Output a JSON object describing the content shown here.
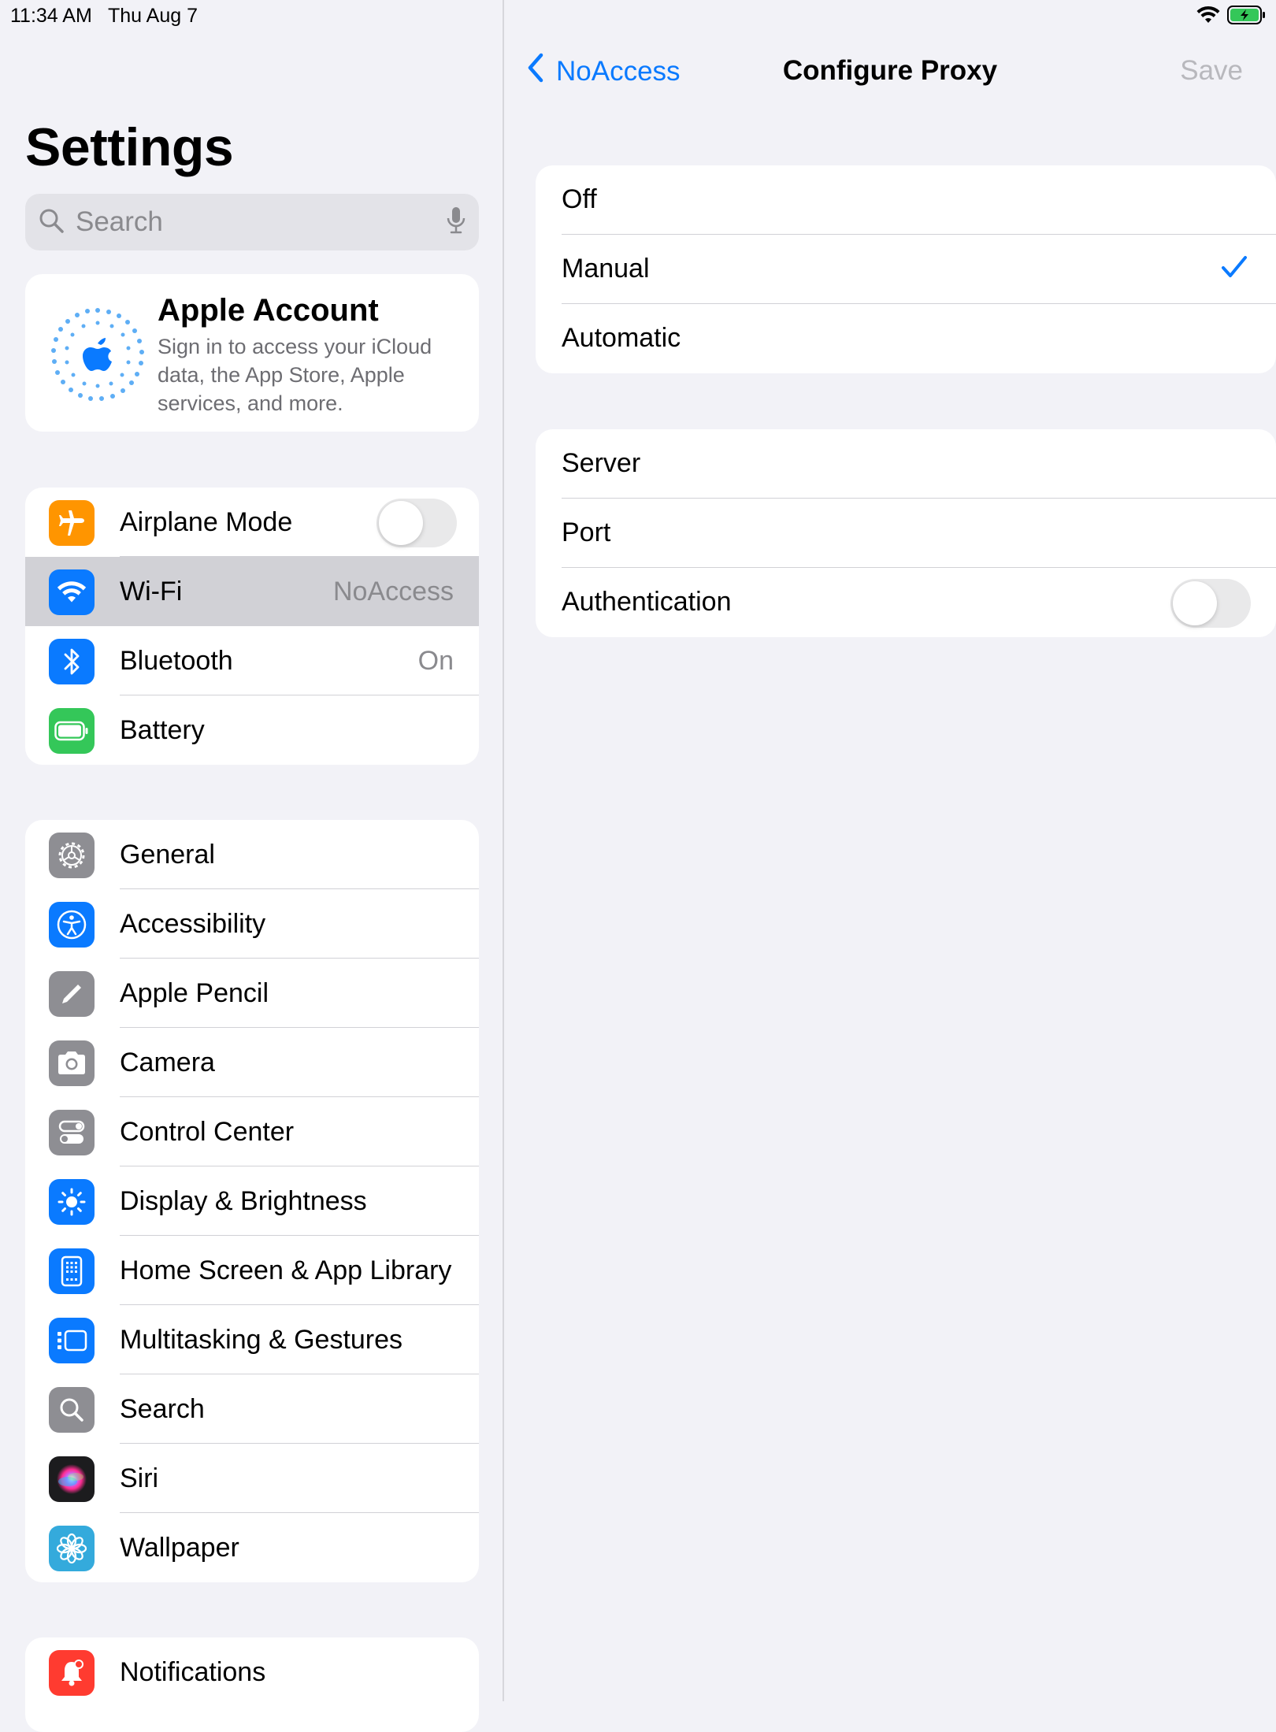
{
  "status_bar": {
    "time": "11:34 AM",
    "date": "Thu Aug 7"
  },
  "sidebar": {
    "title": "Settings",
    "search": {
      "placeholder": "Search"
    },
    "account": {
      "title": "Apple Account",
      "description": "Sign in to access your iCloud data, the App Store, Apple services, and more."
    },
    "group1": [
      {
        "label": "Airplane Mode",
        "icon": "airplane-icon",
        "color": "#ff9500",
        "toggle": false
      },
      {
        "label": "Wi-Fi",
        "icon": "wifi-icon",
        "color": "#0a7aff",
        "value": "NoAccess",
        "selected": true
      },
      {
        "label": "Bluetooth",
        "icon": "bluetooth-icon",
        "color": "#0a7aff",
        "value": "On"
      },
      {
        "label": "Battery",
        "icon": "battery-icon",
        "color": "#34c759"
      }
    ],
    "group2": [
      {
        "label": "General",
        "icon": "gear-icon",
        "color": "#8e8e93"
      },
      {
        "label": "Accessibility",
        "icon": "accessibility-icon",
        "color": "#0a7aff"
      },
      {
        "label": "Apple Pencil",
        "icon": "pencil-icon",
        "color": "#8e8e93"
      },
      {
        "label": "Camera",
        "icon": "camera-icon",
        "color": "#8e8e93"
      },
      {
        "label": "Control Center",
        "icon": "control-center-icon",
        "color": "#8e8e93"
      },
      {
        "label": "Display & Brightness",
        "icon": "sun-icon",
        "color": "#0a7aff"
      },
      {
        "label": "Home Screen & App Library",
        "icon": "home-screen-icon",
        "color": "#0a7aff"
      },
      {
        "label": "Multitasking & Gestures",
        "icon": "multitasking-icon",
        "color": "#0a7aff"
      },
      {
        "label": "Search",
        "icon": "search-icon",
        "color": "#8e8e93"
      },
      {
        "label": "Siri",
        "icon": "siri-icon",
        "color": "#1c1c1e"
      },
      {
        "label": "Wallpaper",
        "icon": "flower-icon",
        "color": "#34aadc"
      }
    ],
    "group3": [
      {
        "label": "Notifications",
        "icon": "bell-icon",
        "color": "#ff3b30"
      }
    ]
  },
  "detail": {
    "back_label": "NoAccess",
    "title": "Configure Proxy",
    "save_label": "Save",
    "modes": [
      {
        "label": "Off"
      },
      {
        "label": "Manual",
        "checked": true
      },
      {
        "label": "Automatic"
      }
    ],
    "fields": [
      {
        "label": "Server"
      },
      {
        "label": "Port"
      },
      {
        "label": "Authentication",
        "toggle": false
      }
    ]
  },
  "colors": {
    "accent": "#0a7aff",
    "background": "#f2f2f7",
    "selected_row": "#d1d1d6",
    "battery_green": "#34c759"
  }
}
